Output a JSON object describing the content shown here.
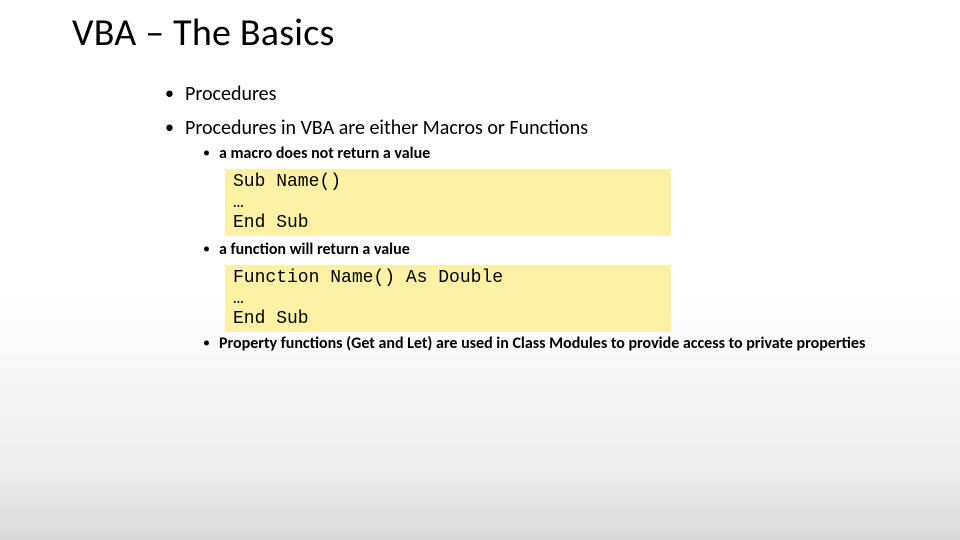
{
  "title": "VBA – The Basics",
  "bullets": {
    "b1": "Procedures",
    "b2": "Procedures in VBA are either Macros or Functions",
    "b2a": "a macro does not return a value",
    "b2b": "a function will return a value",
    "b2c": "Property functions (Get and Let) are used in Class Modules to provide access to private properties"
  },
  "code": {
    "macro": "Sub Name()\n…\nEnd Sub",
    "func": "Function Name() As Double\n…\nEnd Sub"
  }
}
